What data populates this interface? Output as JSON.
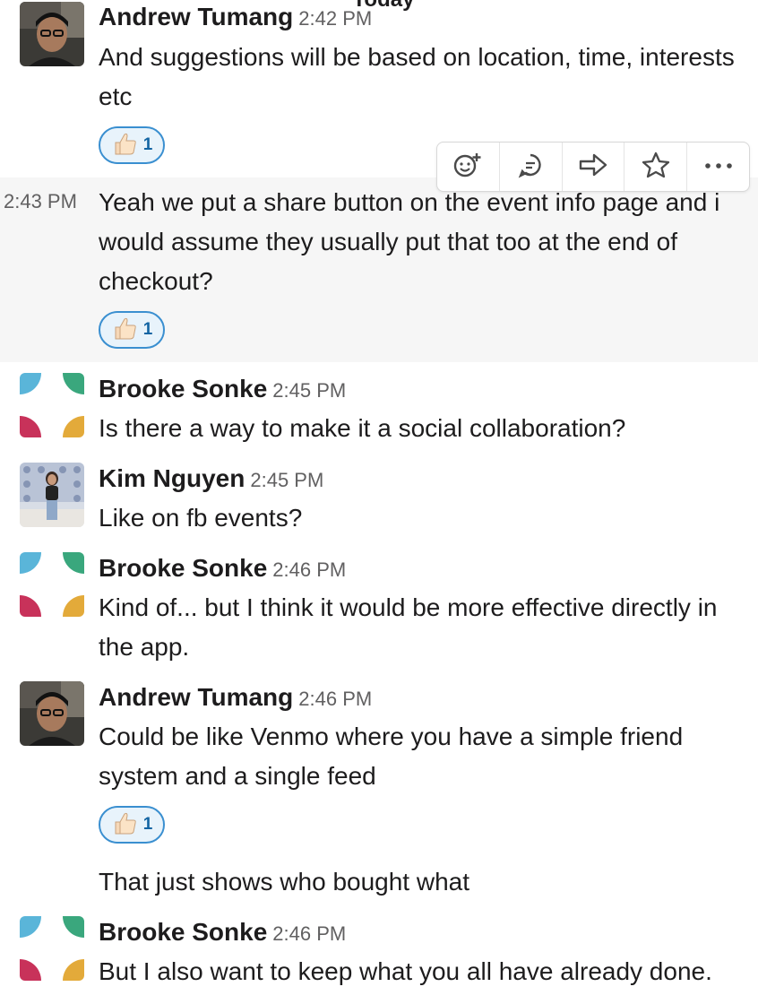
{
  "divider": {
    "label": "Today"
  },
  "hover_toolbar": {
    "icons": [
      "add-reaction-icon",
      "reply-in-thread-icon",
      "share-message-icon",
      "save-star-icon",
      "more-actions-icon"
    ]
  },
  "messages": [
    {
      "author": "Andrew Tumang",
      "time": "2:42 PM",
      "text": "And suggestions will be based on location, time, interests etc",
      "reaction": {
        "emoji": "thumbs-up",
        "count": "1"
      }
    },
    {
      "author": "",
      "time": "2:43 PM",
      "text": "Yeah we put a share button on the event info page and i would assume they usually put that too at the end of checkout?",
      "reaction": {
        "emoji": "thumbs-up",
        "count": "1"
      }
    },
    {
      "author": "Brooke Sonke",
      "time": "2:45 PM",
      "text": "Is there a way to make it a social collaboration?"
    },
    {
      "author": "Kim Nguyen",
      "time": "2:45 PM",
      "text": "Like on fb events?"
    },
    {
      "author": "Brooke Sonke",
      "time": "2:46 PM",
      "text": "Kind of... but I think it would be more effective directly in the app."
    },
    {
      "author": "Andrew Tumang",
      "time": "2:46 PM",
      "text": "Could be like Venmo where you have a simple friend system and a single feed",
      "reaction": {
        "emoji": "thumbs-up",
        "count": "1"
      }
    },
    {
      "author": "",
      "time": "",
      "text": "That just shows who bought what"
    },
    {
      "author": "Brooke Sonke",
      "time": "2:46 PM",
      "text": "But I also want to keep what you all have already done."
    }
  ],
  "colors": {
    "reaction_border": "#3a8fd0",
    "reaction_bg": "#e8f3fb",
    "hover_bg": "#f6f6f6",
    "timestamp": "#616061"
  }
}
